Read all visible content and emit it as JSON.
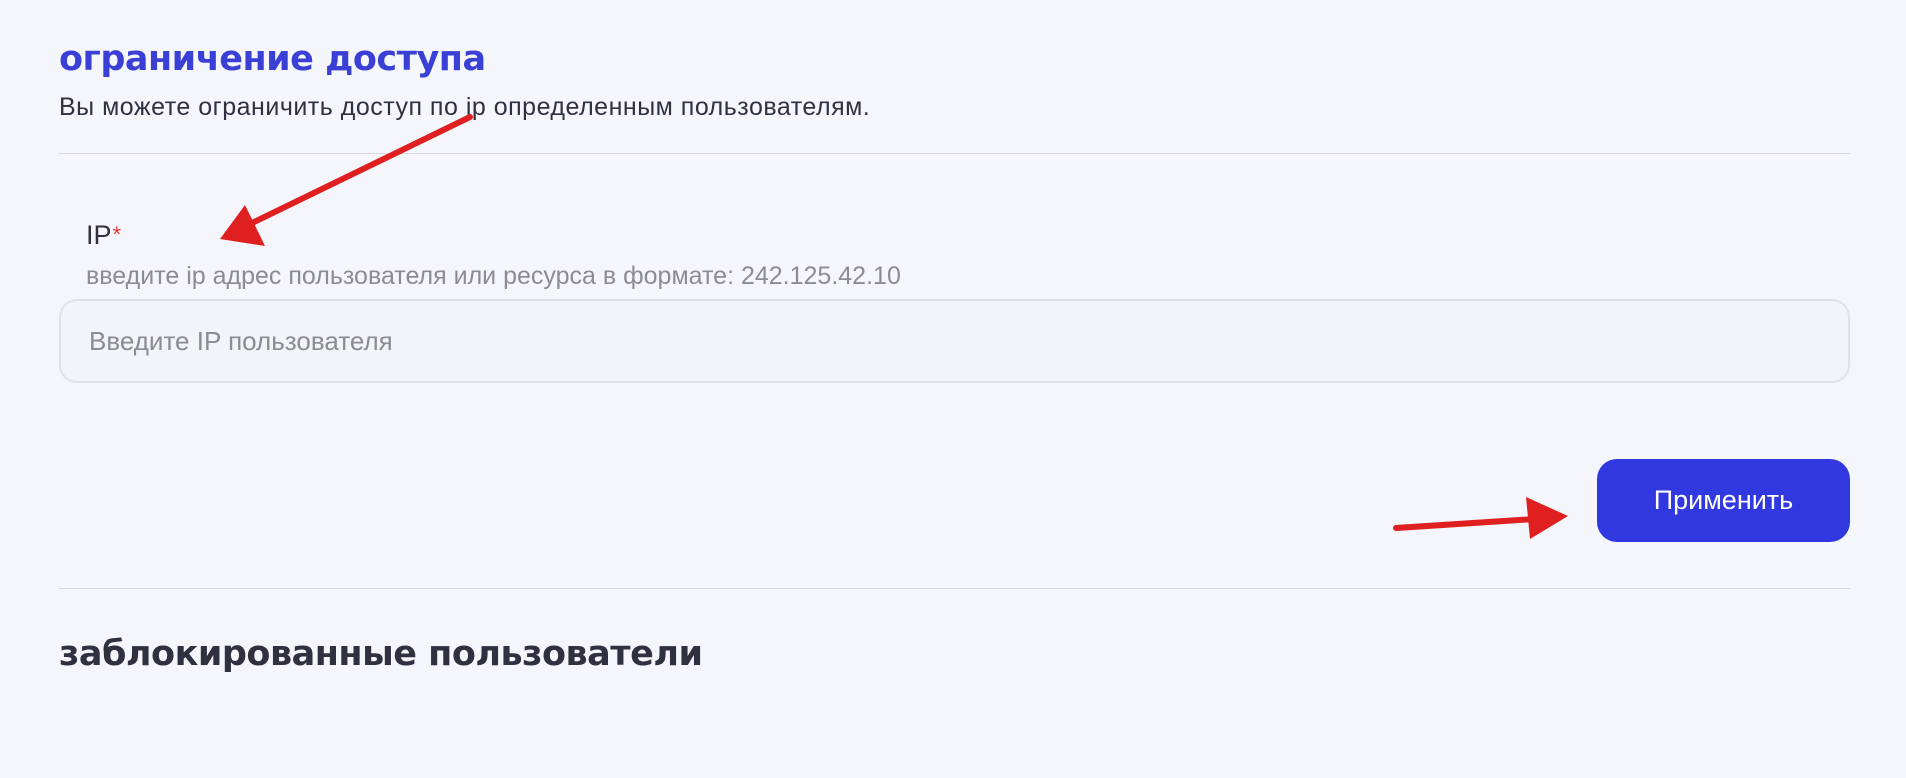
{
  "access_restriction": {
    "title": "ограничение доступа",
    "description": "Вы можете ограничить доступ по ip определенным пользователям."
  },
  "ip_field": {
    "label": "IP",
    "required_mark": "*",
    "hint": "введите ip адрес пользователя или ресурса в формате: 242.125.42.10",
    "value": "",
    "placeholder": "Введите IP пользователя"
  },
  "actions": {
    "apply_label": "Применить"
  },
  "blocked_users": {
    "title": "заблокированные пользователи"
  },
  "colors": {
    "accent": "#3138e0",
    "title_accent": "#3a3fd6",
    "background": "#f5f6fb",
    "required": "#e53935",
    "annotation_arrow": "#e02020"
  },
  "annotations": {
    "arrow_icons": [
      "arrow-to-ip-field",
      "arrow-to-apply-button"
    ]
  }
}
